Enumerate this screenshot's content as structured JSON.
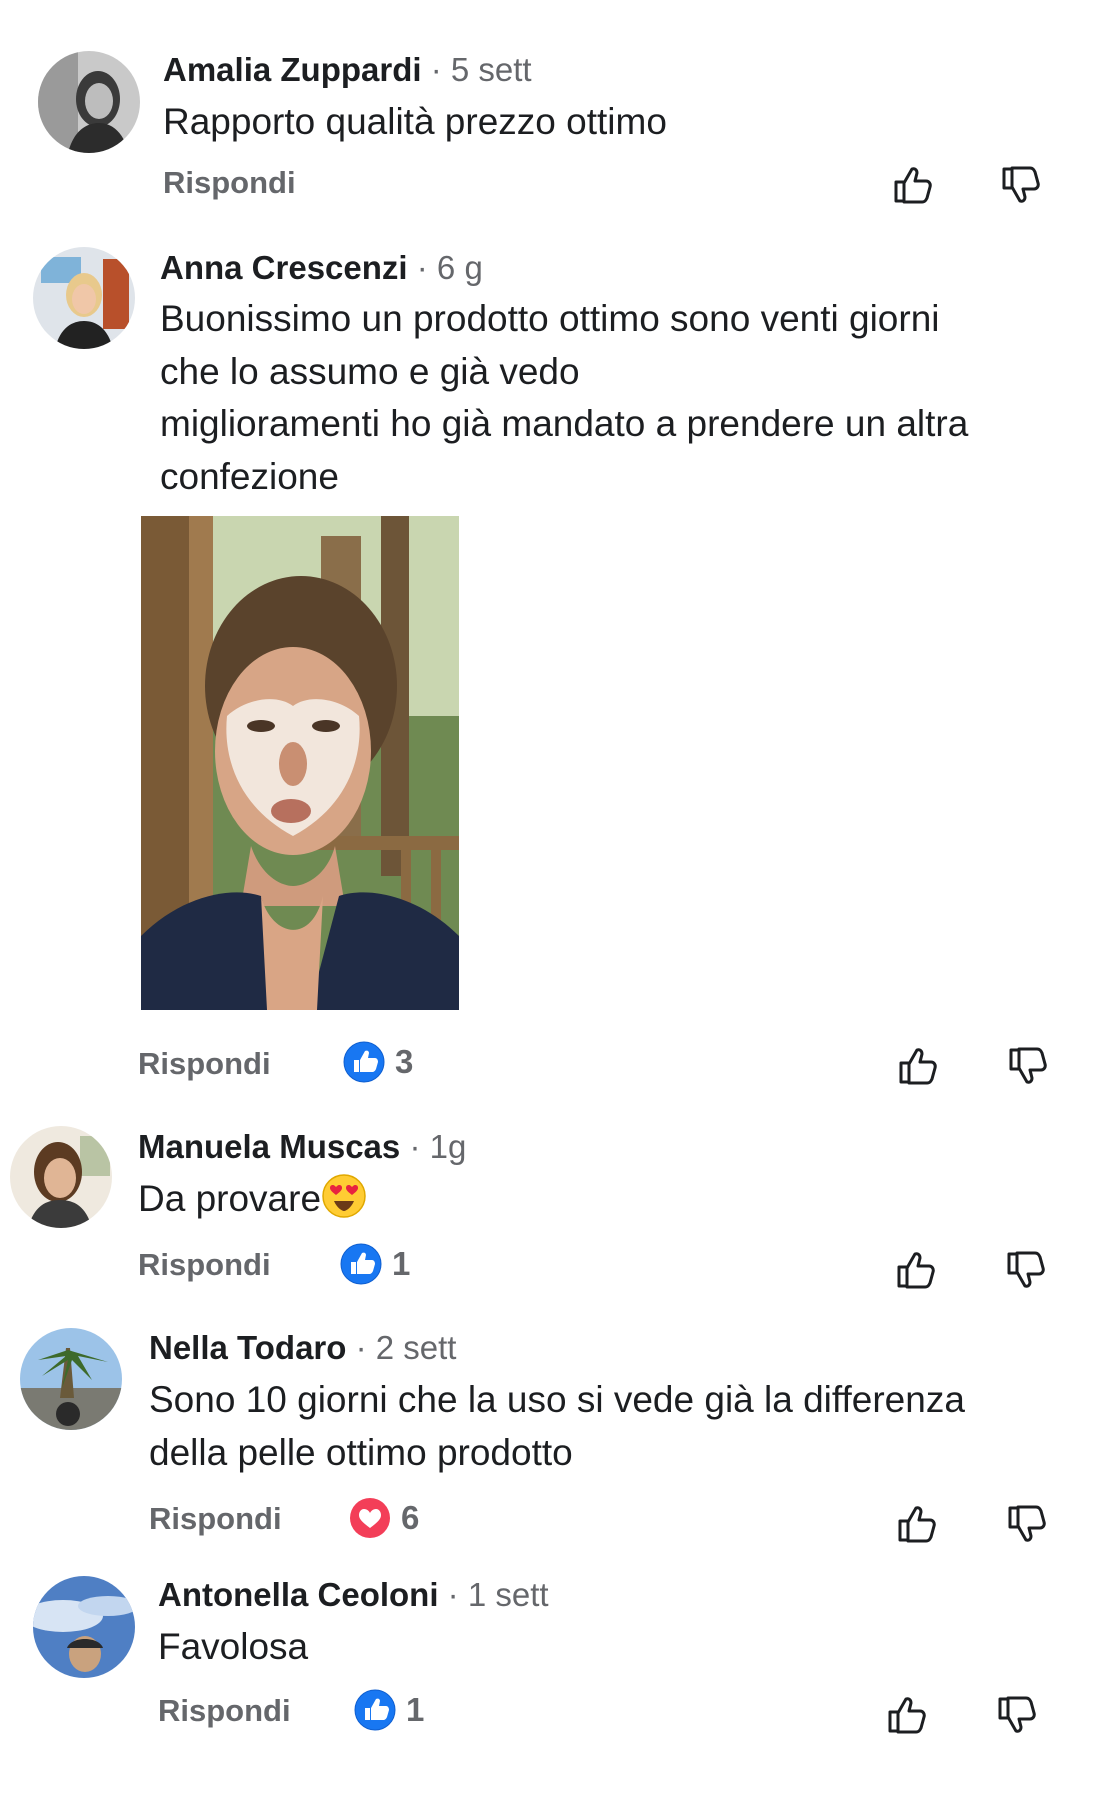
{
  "reply_label": "Rispondi",
  "colors": {
    "like_blue": "#1877f2",
    "love_red": "#f33e58",
    "text": "#1c1e21",
    "secondary": "#65676b"
  },
  "icons": {
    "like": "thumbs-up-outline-icon",
    "dislike": "thumbs-down-outline-icon",
    "like_reaction": "like-reaction-icon",
    "love_reaction": "heart-reaction-icon",
    "emoji": "heart-eyes-emoji"
  },
  "comments": [
    {
      "author": "Amalia Zuppardi",
      "meta": "· 5 sett",
      "lines": [
        "Rapporto qualità prezzo ottimo"
      ]
    },
    {
      "author": "Anna Crescenzi",
      "meta": "· 6 g",
      "lines": [
        "Buonissimo un prodotto ottimo sono venti giorni",
        "che lo assumo e già vedo",
        "miglioramenti ho già mandato a prendere un altra",
        "confezione"
      ],
      "has_photo": true,
      "reaction": {
        "type": "like",
        "count": "3"
      }
    },
    {
      "author": "Manuela Muscas",
      "meta": "· 1g",
      "lines": [
        "Da provare"
      ],
      "reaction": {
        "type": "like",
        "count": "1"
      }
    },
    {
      "author": "Nella Todaro",
      "meta": "· 2 sett",
      "lines": [
        "Sono 10 giorni che la uso si vede già la differenza",
        "della pelle ottimo prodotto"
      ],
      "reaction": {
        "type": "love",
        "count": "6"
      }
    },
    {
      "author": "Antonella Ceoloni",
      "meta": "· 1 sett",
      "lines": [
        "Favolosa"
      ],
      "reaction": {
        "type": "like",
        "count": "1"
      }
    }
  ]
}
